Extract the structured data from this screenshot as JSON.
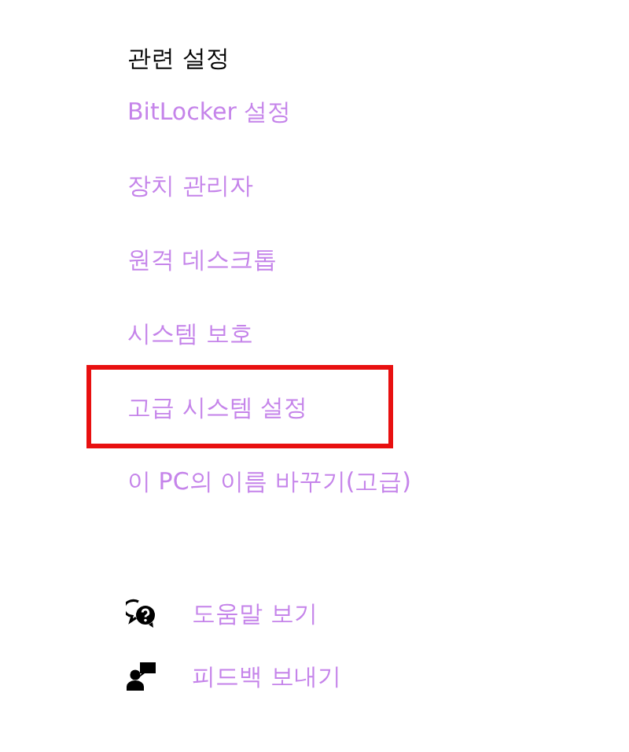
{
  "related_settings": {
    "title": "관련 설정",
    "links": [
      {
        "label": "BitLocker 설정",
        "highlighted": false
      },
      {
        "label": "장치 관리자",
        "highlighted": false
      },
      {
        "label": "원격 데스크톱",
        "highlighted": false
      },
      {
        "label": "시스템 보호",
        "highlighted": false
      },
      {
        "label": "고급 시스템 설정",
        "highlighted": true
      },
      {
        "label": "이 PC의 이름 바꾸기(고급)",
        "highlighted": false
      }
    ]
  },
  "help_links": [
    {
      "kind": "help",
      "label": "도움말 보기"
    },
    {
      "kind": "feedback",
      "label": "피드백 보내기"
    }
  ]
}
